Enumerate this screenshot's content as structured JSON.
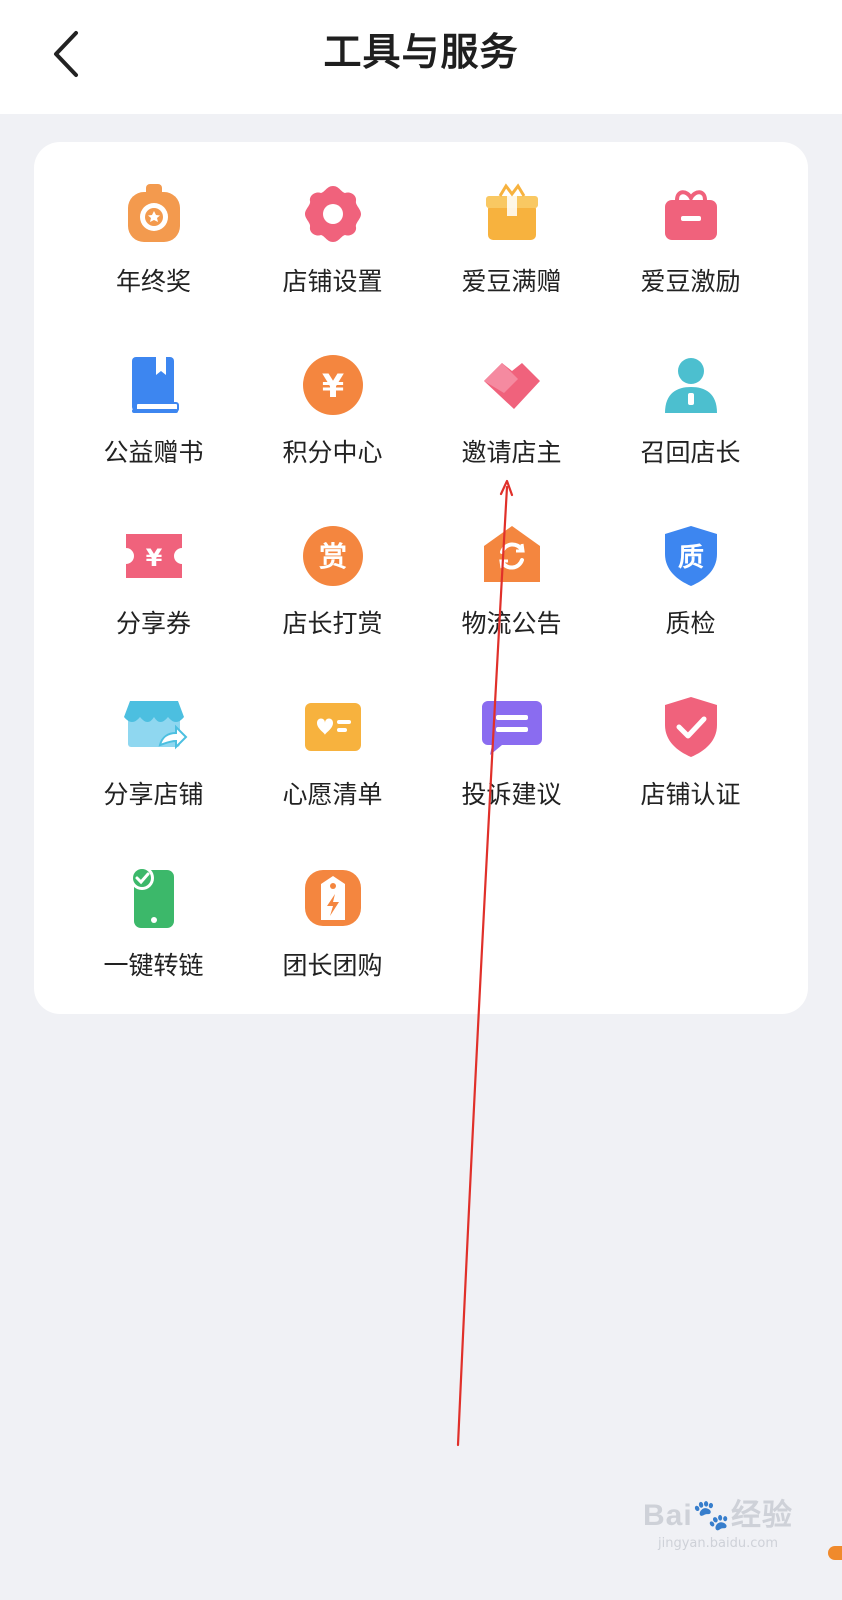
{
  "header": {
    "title": "工具与服务",
    "back_icon": "chevron-left-icon"
  },
  "tools": [
    {
      "id": "year-end-bonus",
      "label": "年终奖",
      "icon": "medal-icon",
      "color": "#f39a4e"
    },
    {
      "id": "shop-settings",
      "label": "店铺设置",
      "icon": "gear-icon",
      "color": "#f0627c"
    },
    {
      "id": "aidou-gift",
      "label": "爱豆满赠",
      "icon": "gift-box-icon",
      "color": "#f7b23e"
    },
    {
      "id": "aidou-incentive",
      "label": "爱豆激励",
      "icon": "gift-icon",
      "color": "#f0627c"
    },
    {
      "id": "charity-books",
      "label": "公益赠书",
      "icon": "book-icon",
      "color": "#3d86f0"
    },
    {
      "id": "points-center",
      "label": "积分中心",
      "icon": "yuan-coin-icon",
      "color": "#f4863f"
    },
    {
      "id": "invite-owner",
      "label": "邀请店主",
      "icon": "handshake-icon",
      "color": "#f0627c"
    },
    {
      "id": "recall-manager",
      "label": "召回店长",
      "icon": "person-icon",
      "color": "#4cbfcf"
    },
    {
      "id": "share-coupon",
      "label": "分享券",
      "icon": "coupon-icon",
      "color": "#f0627c"
    },
    {
      "id": "manager-reward",
      "label": "店长打赏",
      "icon": "reward-coin-icon",
      "color": "#f4863f"
    },
    {
      "id": "logistics-notice",
      "label": "物流公告",
      "icon": "refresh-house-icon",
      "color": "#f4863f"
    },
    {
      "id": "quality-check",
      "label": "质检",
      "icon": "quality-shield-icon",
      "color": "#3d86f0"
    },
    {
      "id": "share-shop",
      "label": "分享店铺",
      "icon": "share-store-icon",
      "color": "#4cbfe0"
    },
    {
      "id": "wish-list",
      "label": "心愿清单",
      "icon": "wish-card-icon",
      "color": "#f7b23e"
    },
    {
      "id": "complaint-suggestion",
      "label": "投诉建议",
      "icon": "chat-bubble-icon",
      "color": "#8a6cf0"
    },
    {
      "id": "shop-certification",
      "label": "店铺认证",
      "icon": "check-shield-icon",
      "color": "#f0627c"
    },
    {
      "id": "one-key-link",
      "label": "一键转链",
      "icon": "phone-check-icon",
      "color": "#3cb86a"
    },
    {
      "id": "group-buy",
      "label": "团长团购",
      "icon": "bolt-tag-icon",
      "color": "#f4863f"
    }
  ],
  "watermark": {
    "brand": "Bai",
    "brand_suffix": "经验",
    "url": "jingyan.baidu.com"
  },
  "colors": {
    "background": "#f0f1f5",
    "card": "#ffffff",
    "annotation_arrow": "#e0302a"
  }
}
